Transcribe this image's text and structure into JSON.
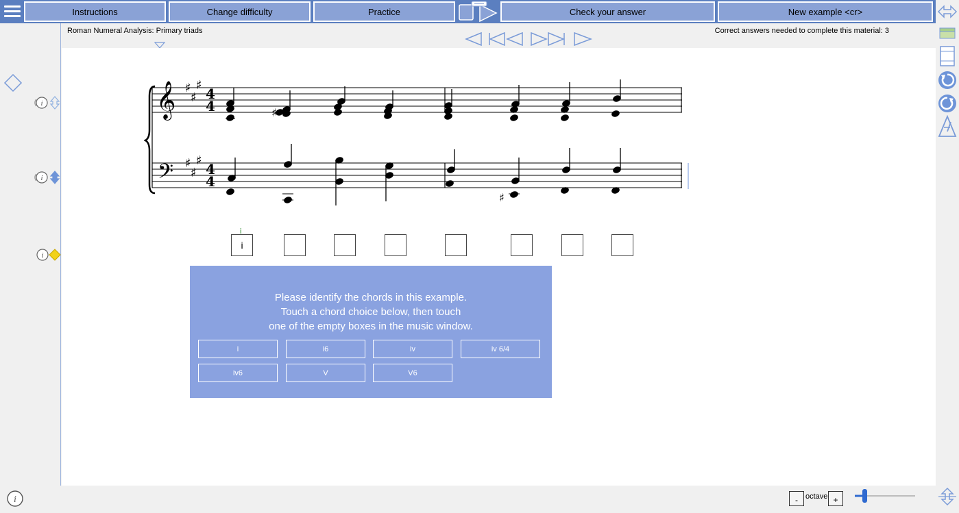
{
  "toolbar": {
    "instructions": "Instructions",
    "change_difficulty": "Change difficulty",
    "practice": "Practice",
    "check_answer": "Check your answer",
    "new_example": "New example <cr>"
  },
  "header": {
    "title": "Roman Numeral Analysis: Primary triads",
    "correct_needed": "Correct answers needed to complete this material: 3"
  },
  "answers": {
    "boxes": [
      "i",
      "",
      "",
      "",
      "",
      "",
      "",
      ""
    ],
    "hint": "i"
  },
  "instructions_panel": {
    "line1": "Please identify the chords in this example.",
    "line2": "Touch a chord choice below, then touch",
    "line3": "one of the empty boxes in the music window.",
    "choices": [
      "i",
      "i6",
      "iv",
      "iv 6/4",
      "iv6",
      "V",
      "V6"
    ]
  },
  "bottom": {
    "minus": "-",
    "octave": "octave",
    "plus": "+"
  },
  "colors": {
    "toolbar": "#5b7fc0",
    "button": "#8aa2d6",
    "panel": "#8aa2e0",
    "accent_yellow": "#f2d21a"
  }
}
